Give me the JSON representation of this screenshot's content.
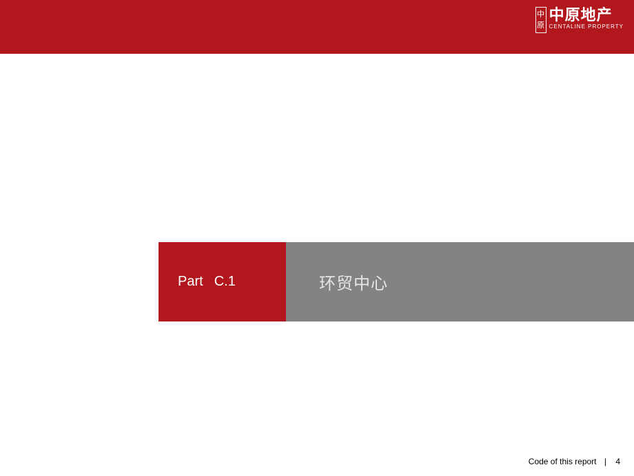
{
  "header": {
    "logo": {
      "seal_chars": "中原",
      "cn": "中原地产",
      "en": "CENTALINE PROPERTY"
    }
  },
  "section": {
    "part_word": "Part",
    "part_number": "C.1",
    "title": "环贸中心"
  },
  "footer": {
    "label": "Code of this report",
    "page": "4"
  }
}
